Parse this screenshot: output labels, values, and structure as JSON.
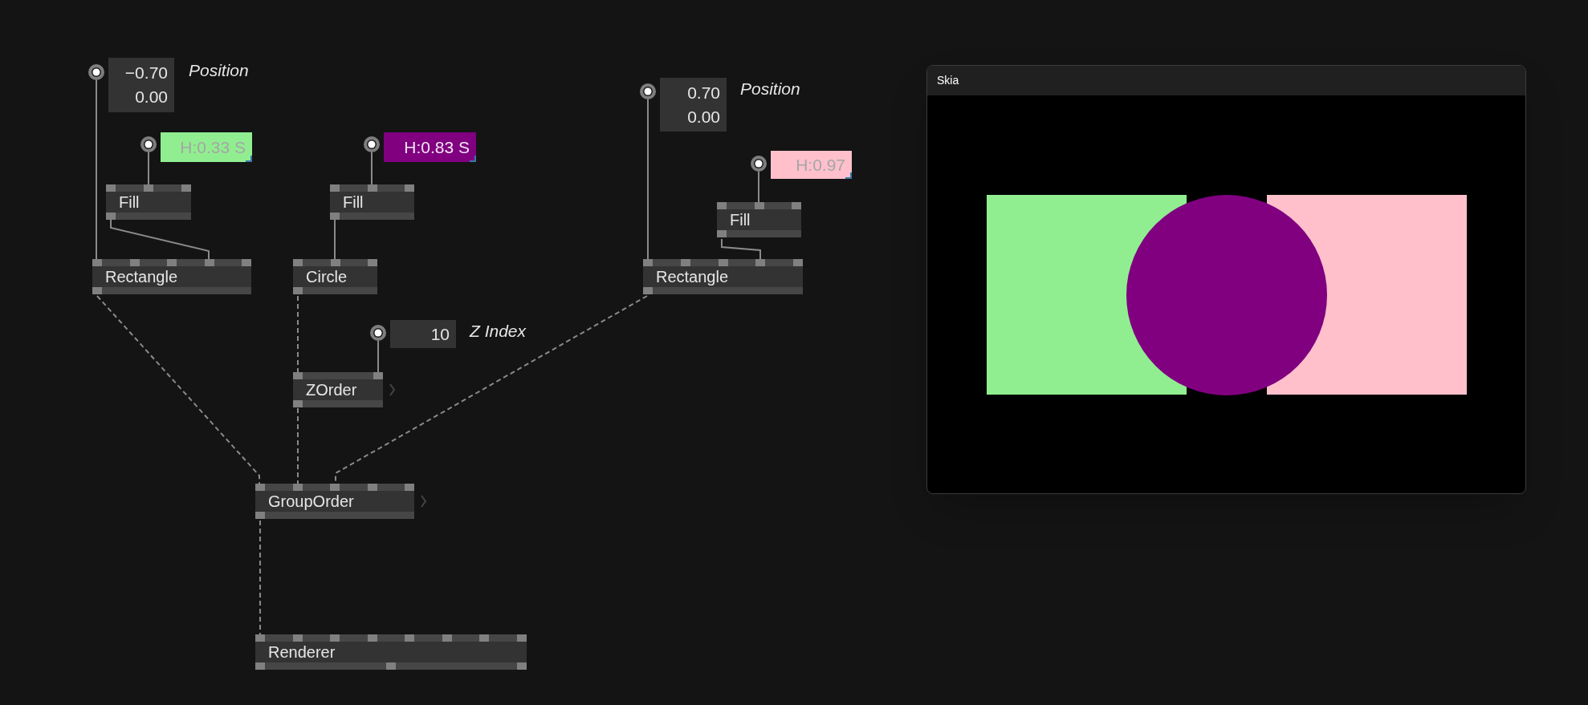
{
  "patch": {
    "pads": [
      {
        "kind": "vector",
        "values": [
          "−0.70",
          "0.00"
        ],
        "label": "Position"
      },
      {
        "kind": "color",
        "value": "H:0.33 S",
        "color": "#90ee90"
      },
      {
        "kind": "color",
        "value": "H:0.83 S",
        "color": "#800080"
      },
      {
        "kind": "number",
        "values": [
          "10"
        ],
        "label": "Z Index"
      },
      {
        "kind": "vector",
        "values": [
          "0.70",
          "0.00"
        ],
        "label": "Position"
      },
      {
        "kind": "color",
        "value": "H:0.97",
        "color": "#ffc0cb"
      }
    ],
    "nodes": [
      {
        "label": "Fill",
        "expandable": false
      },
      {
        "label": "Rectangle",
        "expandable": false
      },
      {
        "label": "Fill",
        "expandable": false
      },
      {
        "label": "Circle",
        "expandable": false
      },
      {
        "label": "ZOrder",
        "expandable": true
      },
      {
        "label": "Fill",
        "expandable": false
      },
      {
        "label": "Rectangle",
        "expandable": false
      },
      {
        "label": "GroupOrder",
        "expandable": true
      },
      {
        "label": "Renderer",
        "expandable": false
      }
    ]
  },
  "renderer_window": {
    "title": "Skia",
    "shapes": [
      {
        "kind": "rect",
        "color": "#90ee90"
      },
      {
        "kind": "rect",
        "color": "#ffc0cb"
      },
      {
        "kind": "circle",
        "color": "#800080"
      }
    ]
  }
}
